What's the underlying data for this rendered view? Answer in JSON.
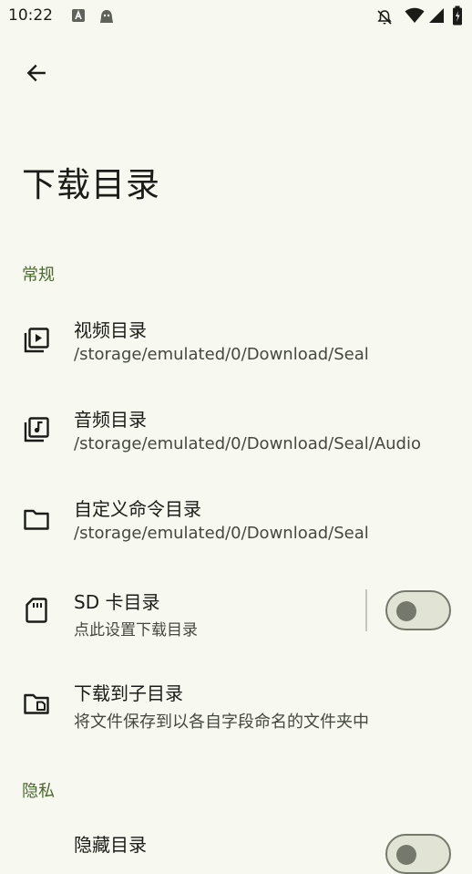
{
  "status_bar": {
    "time": "10:22"
  },
  "page": {
    "title": "下载目录"
  },
  "sections": {
    "general": "常规",
    "privacy": "隐私"
  },
  "items": {
    "video": {
      "title": "视频目录",
      "subtitle": "/storage/emulated/0/Download/Seal"
    },
    "audio": {
      "title": "音频目录",
      "subtitle": "/storage/emulated/0/Download/Seal/Audio"
    },
    "custom": {
      "title": "自定义命令目录",
      "subtitle": "/storage/emulated/0/Download/Seal"
    },
    "sdcard": {
      "title": "SD 卡目录",
      "subtitle": "点此设置下载目录",
      "enabled": false
    },
    "subdir": {
      "title": "下载到子目录",
      "subtitle": "将文件保存到以各自字段命名的文件夹中"
    },
    "hidden": {
      "title": "隐藏目录"
    }
  },
  "colors": {
    "background": "#f7f8f0",
    "accent": "#4a6a2c",
    "outline": "#75796c"
  }
}
